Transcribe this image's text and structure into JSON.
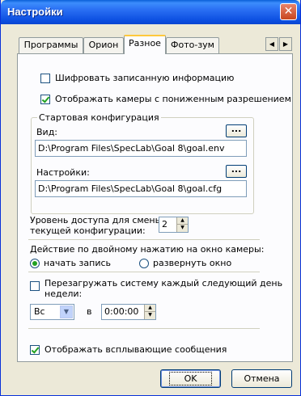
{
  "window": {
    "title": "Настройки",
    "close_glyph": "✕"
  },
  "tabs": [
    {
      "label": "Программы"
    },
    {
      "label": "Орион"
    },
    {
      "label": "Разное"
    },
    {
      "label": "Фото-зум"
    }
  ],
  "tab_scroll": {
    "left": "◀",
    "right": "▶"
  },
  "encrypt": {
    "label": "Шифровать записанную информацию",
    "checked": false
  },
  "lowres": {
    "label": "Отображать камеры с пониженным разрешением",
    "checked": true
  },
  "startup": {
    "title": "Стартовая конфигурация",
    "view_label": "Вид:",
    "view_path": "D:\\Program Files\\SpecLab\\Goal 8\\goal.env",
    "settings_label": "Настройки:",
    "settings_path": "D:\\Program Files\\SpecLab\\Goal 8\\goal.cfg",
    "browse_label": "..."
  },
  "access": {
    "label_line1": "Уровень доступа для смены",
    "label_line2": "текущей конфигурации:",
    "value": "2"
  },
  "doubleclick": {
    "label": "Действие по двойному нажатию на окно камеры:",
    "option_record": "начать запись",
    "option_expand": "развернуть окно",
    "selected": "record"
  },
  "reboot": {
    "label_line1": "Перезагружать систему каждый следующий день",
    "label_line2": "недели:",
    "checked": false,
    "day": "Вс",
    "at": "в",
    "time": "0:00:00"
  },
  "popups": {
    "label": "Отображать всплывающие сообщения",
    "checked": true
  },
  "buttons": {
    "ok": "OK",
    "cancel": "Отмена"
  }
}
